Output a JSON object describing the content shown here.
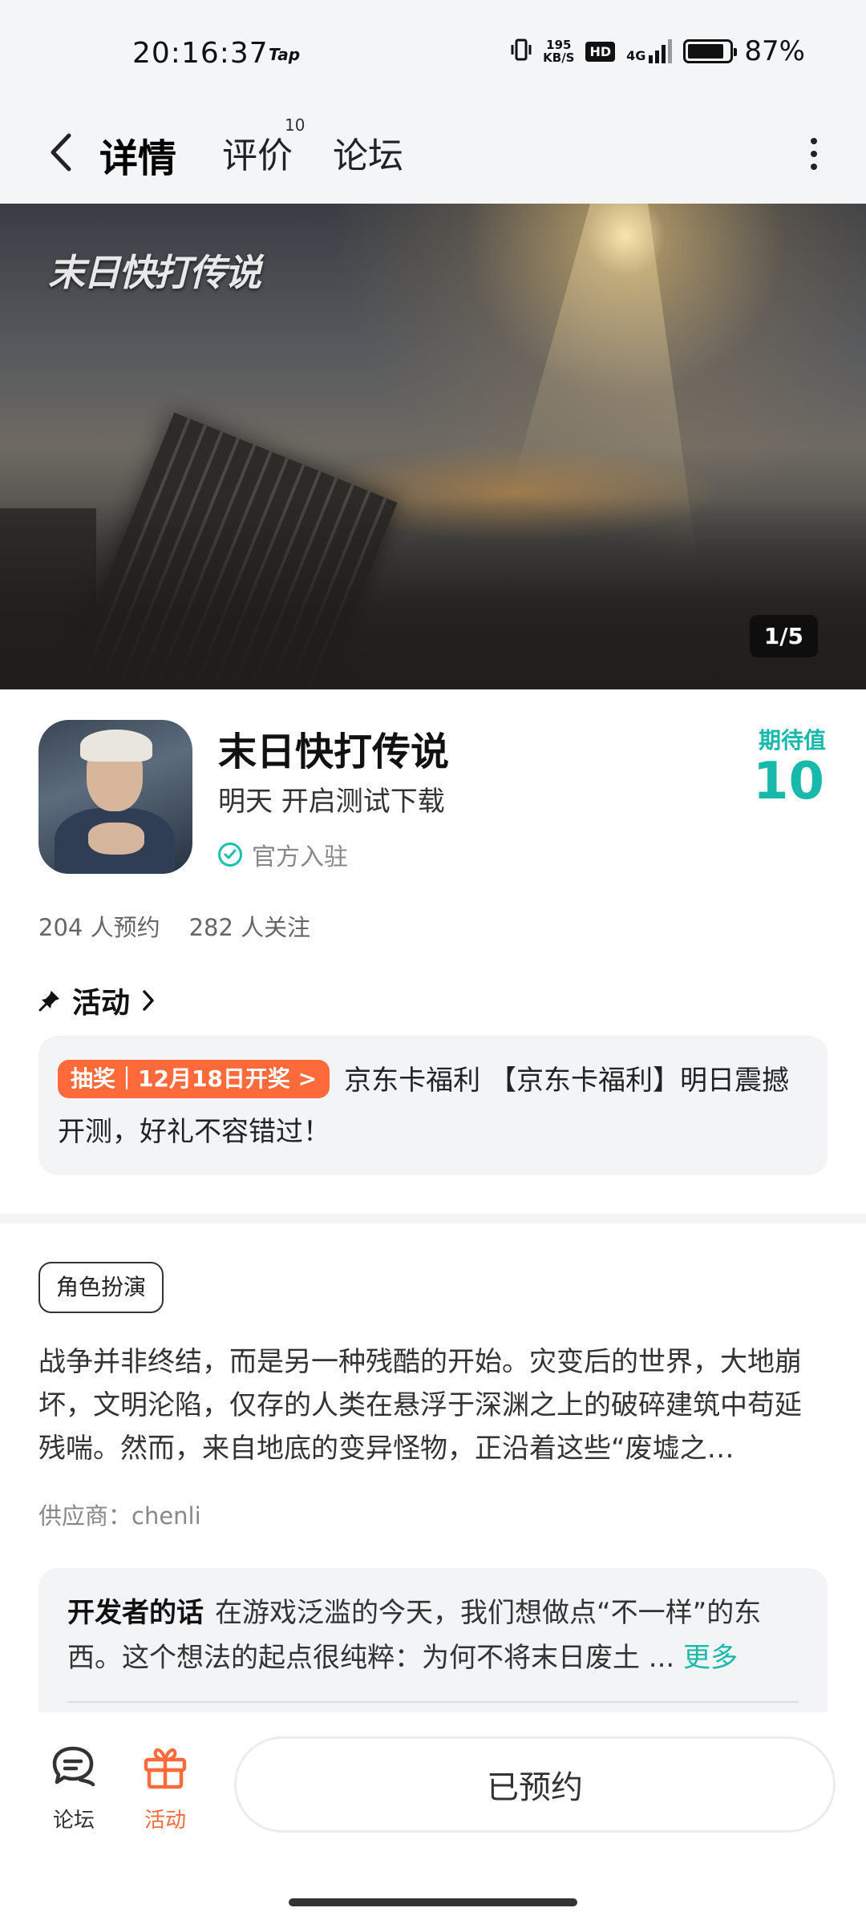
{
  "status_bar": {
    "time": "20:16:37",
    "tap_label": "Tap",
    "net_speed_value": "195",
    "net_speed_unit": "KB/S",
    "hd": "HD",
    "network": "4G",
    "battery_percent_text": "87%",
    "battery_level": 0.87
  },
  "nav": {
    "tabs": [
      {
        "label": "详情",
        "active": true
      },
      {
        "label": "评价",
        "count": "10"
      },
      {
        "label": "论坛"
      }
    ]
  },
  "banner": {
    "logo_text": "末日快打传说",
    "counter": "1/5"
  },
  "game": {
    "title": "末日快打传说",
    "subtitle": "明天 开启测试下载",
    "official_label": "官方入驻",
    "expect_label": "期待值",
    "expect_value": "10",
    "reservations": "204 人预约",
    "followers": "282 人关注"
  },
  "activity": {
    "header": "活动",
    "tag": "抽奖｜12月18日开奖 >",
    "text": "京东卡福利 【京东卡福利】明日震撼开测，好礼不容错过！"
  },
  "details": {
    "genre": "角色扮演",
    "description": "战争并非终结，而是另一种残酷的开始。灾变后的世界，大地崩坏，文明沦陷，仅存的人类在悬浮于深渊之上的破碎建筑中苟延残喘。然而，来自地底的变异怪物，正沿着这些“废墟之…",
    "supplier": "供应商：chenli"
  },
  "developer": {
    "title": "开发者的话",
    "text": "在游戏泛滥的今天，我们想做点“不一样”的东西。这个想法的起点很纯粹：为何不将末日废土 ...",
    "more": "更多"
  },
  "bottom_bar": {
    "forum_label": "论坛",
    "activity_label": "活动",
    "reserve_button": "已预约"
  },
  "colors": {
    "accent": "#18c1b3",
    "orange": "#ff6a3a"
  }
}
